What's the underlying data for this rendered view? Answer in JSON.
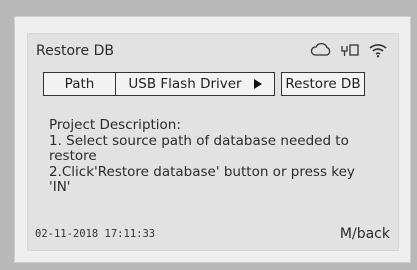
{
  "screen": {
    "title": "Restore DB",
    "status_icons": [
      "cloud-icon",
      "usb-icon",
      "wifi-icon"
    ]
  },
  "path_row": {
    "path_label": "Path",
    "source_value": "USB Flash Driver",
    "restore_button": "Restore DB"
  },
  "description": {
    "lines": [
      "Project Description:",
      "1. Select source path of database needed to",
      "restore",
      "2.Click'Restore database' button or press key",
      "'IN'"
    ]
  },
  "footer": {
    "datetime": "02-11-2018  17:11:33",
    "back_hint": "M/back"
  }
}
